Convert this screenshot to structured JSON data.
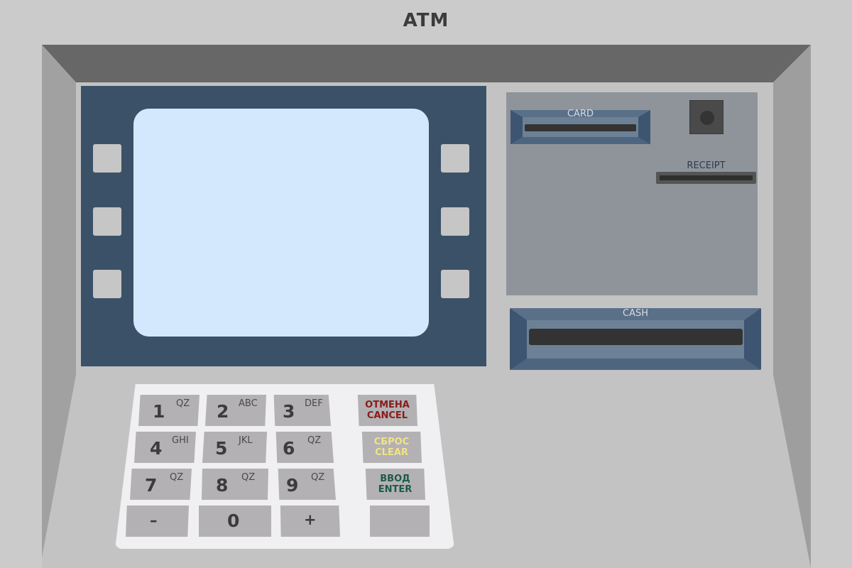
{
  "title": "ATM",
  "slots": {
    "card_label": "CARD",
    "receipt_label": "RECEIPT",
    "cash_label": "CASH"
  },
  "keypad": {
    "digits": [
      {
        "num": "1",
        "letters": "QZ"
      },
      {
        "num": "2",
        "letters": "ABC"
      },
      {
        "num": "3",
        "letters": "DEF"
      },
      {
        "num": "4",
        "letters": "GHI"
      },
      {
        "num": "5",
        "letters": "JKL"
      },
      {
        "num": "6",
        "letters": "QZ"
      },
      {
        "num": "7",
        "letters": "QZ"
      },
      {
        "num": "8",
        "letters": "QZ"
      },
      {
        "num": "9",
        "letters": "QZ"
      },
      {
        "num": "–",
        "letters": ""
      },
      {
        "num": "0",
        "letters": ""
      },
      {
        "num": "+",
        "letters": ""
      }
    ],
    "cancel": {
      "line1": "ОТМЕНА",
      "line2": "CANCEL"
    },
    "clear": {
      "line1": "СБРОС",
      "line2": "CLEAR"
    },
    "enter": {
      "line1": "ВВОД",
      "line2": "ENTER"
    }
  },
  "colors": {
    "cancel": "#8b1a1a",
    "clear": "#f2e285",
    "enter": "#1d5a49"
  }
}
